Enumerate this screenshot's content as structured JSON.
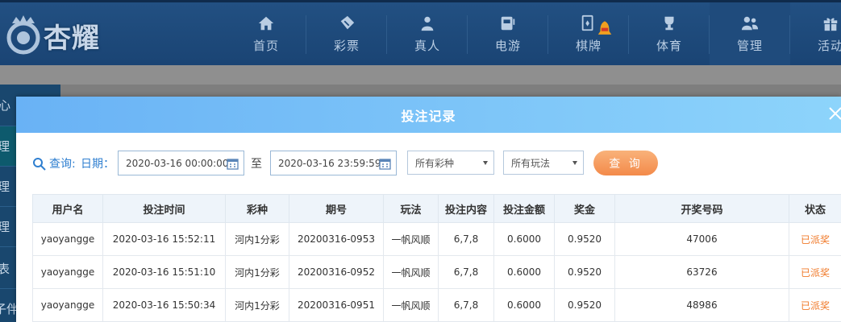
{
  "brand": {
    "name": "杏耀"
  },
  "nav": {
    "items": [
      {
        "label": "首页",
        "icon": "home-icon"
      },
      {
        "label": "彩票",
        "icon": "ticket-icon"
      },
      {
        "label": "真人",
        "icon": "dealer-icon"
      },
      {
        "label": "电游",
        "icon": "slot-machine-icon"
      },
      {
        "label": "棋牌",
        "icon": "cards-icon"
      },
      {
        "label": "体育",
        "icon": "trophy-icon"
      },
      {
        "label": "管理",
        "icon": "users-icon"
      },
      {
        "label": "活动",
        "icon": "gift-icon"
      }
    ]
  },
  "sidebar": {
    "items": [
      {
        "label": "心"
      },
      {
        "label": "理"
      },
      {
        "label": "理"
      },
      {
        "label": "理"
      },
      {
        "label": "表"
      },
      {
        "label": "子伴"
      }
    ]
  },
  "modal": {
    "title": "投注记录",
    "filters": {
      "query_label": "查询:",
      "date_label": "日期：",
      "start_date": "2020-03-16 00:00:00",
      "to_label": "至",
      "end_date": "2020-03-16 23:59:59",
      "lottery_select": "所有彩种",
      "play_select": "所有玩法",
      "query_button": "查 询"
    },
    "table": {
      "columns": [
        "用户名",
        "投注时间",
        "彩种",
        "期号",
        "玩法",
        "投注内容",
        "投注金额",
        "奖金",
        "开奖号码",
        "状态"
      ],
      "rows": [
        [
          "yaoyangge",
          "2020-03-16 15:52:11",
          "河内1分彩",
          "20200316-0953",
          "一帆风顺",
          "6,7,8",
          "0.6000",
          "0.9520",
          "47006",
          "已派奖"
        ],
        [
          "yaoyangge",
          "2020-03-16 15:51:10",
          "河内1分彩",
          "20200316-0952",
          "一帆风顺",
          "6,7,8",
          "0.6000",
          "0.9520",
          "63726",
          "已派奖"
        ],
        [
          "yaoyangge",
          "2020-03-16 15:50:34",
          "河内1分彩",
          "20200316-0951",
          "一帆风顺",
          "6,7,8",
          "0.6000",
          "0.9520",
          "48986",
          "已派奖"
        ]
      ]
    }
  },
  "colors": {
    "nav_bg": "#1f4b7c",
    "modal_header": "#7cc4f8",
    "accent_blue": "#2f7fd0",
    "query_button": "#f59a5a",
    "status_paid": "#f07a2a"
  }
}
